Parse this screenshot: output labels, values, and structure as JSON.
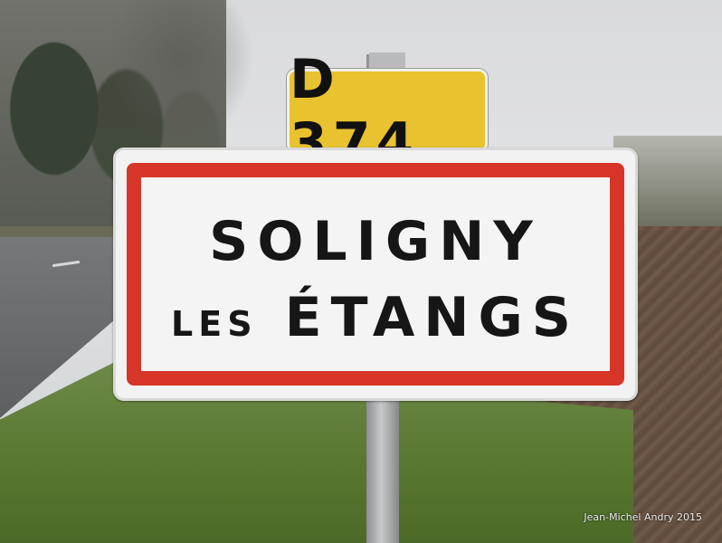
{
  "route_plate": {
    "text": "D 374",
    "color": "#e9c22f"
  },
  "town_sign": {
    "line1": "SOLIGNY",
    "line2_small": "LES",
    "line2_big": "ÉTANGS",
    "border_color": "#d63528"
  },
  "credit": "Jean-Michel Andry 2015"
}
